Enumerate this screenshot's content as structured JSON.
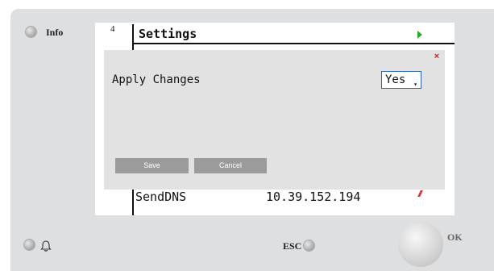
{
  "hardware": {
    "info_label": "Info",
    "esc_label": "ESC",
    "ok_label": "OK"
  },
  "screen": {
    "page_number": "4",
    "title": "Settings",
    "background_row": {
      "label": "SendDNS",
      "value": "10.39.152.194"
    }
  },
  "dialog": {
    "label": "Apply Changes",
    "select_value": "Yes",
    "select_caret": "▾",
    "close_symbol": "×",
    "save_label": "Save",
    "cancel_label": "Cancel"
  },
  "colors": {
    "panel": "#dedfe0",
    "arrow": "#2aaa2a",
    "close": "#c0282d",
    "button": "#9b9b9b",
    "select_border": "#2b5fa8"
  },
  "icons": [
    "bell-icon",
    "right-arrow-icon",
    "close-icon",
    "dropdown-caret-icon"
  ]
}
